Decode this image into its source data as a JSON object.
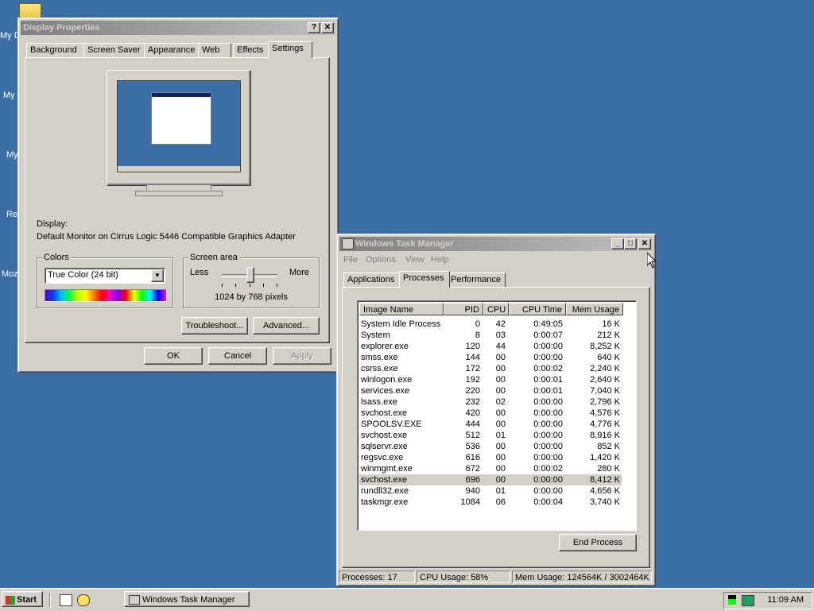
{
  "desktop": {
    "icons": [
      "My D",
      "My",
      "My",
      "Re",
      "Moz"
    ]
  },
  "display_properties": {
    "title": "Display Properties",
    "help_btn": "?",
    "close_btn": "✕",
    "tabs": [
      "Background",
      "Screen Saver",
      "Appearance",
      "Web",
      "Effects",
      "Settings"
    ],
    "active_tab": "Settings",
    "display_label": "Display:",
    "display_value": "Default Monitor on Cirrus Logic 5446 Compatible Graphics Adapter",
    "colors_label": "Colors",
    "colors_value": "True Color (24 bit)",
    "screen_area_label": "Screen area",
    "less": "Less",
    "more": "More",
    "resolution": "1024 by 768 pixels",
    "troubleshoot": "Troubleshoot...",
    "advanced": "Advanced...",
    "ok": "OK",
    "cancel": "Cancel",
    "apply": "Apply"
  },
  "task_manager": {
    "title": "Windows Task Manager",
    "menu": [
      "File",
      "Options",
      "View",
      "Help"
    ],
    "tabs": [
      "Applications",
      "Processes",
      "Performance"
    ],
    "active_tab": "Processes",
    "columns": [
      "Image Name",
      "PID",
      "CPU",
      "CPU Time",
      "Mem Usage"
    ],
    "processes": [
      {
        "name": "System Idle Process",
        "pid": "0",
        "cpu": "42",
        "time": "0:49:05",
        "mem": "16 K"
      },
      {
        "name": "System",
        "pid": "8",
        "cpu": "03",
        "time": "0:00:07",
        "mem": "212 K"
      },
      {
        "name": "explorer.exe",
        "pid": "120",
        "cpu": "44",
        "time": "0:00:00",
        "mem": "8,252 K"
      },
      {
        "name": "smss.exe",
        "pid": "144",
        "cpu": "00",
        "time": "0:00:00",
        "mem": "640 K"
      },
      {
        "name": "csrss.exe",
        "pid": "172",
        "cpu": "00",
        "time": "0:00:02",
        "mem": "2,240 K"
      },
      {
        "name": "winlogon.exe",
        "pid": "192",
        "cpu": "00",
        "time": "0:00:01",
        "mem": "2,640 K"
      },
      {
        "name": "services.exe",
        "pid": "220",
        "cpu": "00",
        "time": "0:00:01",
        "mem": "7,040 K"
      },
      {
        "name": "lsass.exe",
        "pid": "232",
        "cpu": "02",
        "time": "0:00:00",
        "mem": "2,796 K"
      },
      {
        "name": "svchost.exe",
        "pid": "420",
        "cpu": "00",
        "time": "0:00:00",
        "mem": "4,576 K"
      },
      {
        "name": "SPOOLSV.EXE",
        "pid": "444",
        "cpu": "00",
        "time": "0:00:00",
        "mem": "4,776 K"
      },
      {
        "name": "svchost.exe",
        "pid": "512",
        "cpu": "01",
        "time": "0:00:00",
        "mem": "8,916 K"
      },
      {
        "name": "sqlservr.exe",
        "pid": "536",
        "cpu": "00",
        "time": "0:00:00",
        "mem": "852 K"
      },
      {
        "name": "regsvc.exe",
        "pid": "616",
        "cpu": "00",
        "time": "0:00:00",
        "mem": "1,420 K"
      },
      {
        "name": "winmgmt.exe",
        "pid": "672",
        "cpu": "00",
        "time": "0:00:02",
        "mem": "280 K"
      },
      {
        "name": "svchost.exe",
        "pid": "696",
        "cpu": "00",
        "time": "0:00:00",
        "mem": "8,412 K"
      },
      {
        "name": "rundll32.exe",
        "pid": "940",
        "cpu": "01",
        "time": "0:00:00",
        "mem": "4,656 K"
      },
      {
        "name": "taskmgr.exe",
        "pid": "1084",
        "cpu": "06",
        "time": "0:00:04",
        "mem": "3,740 K"
      }
    ],
    "selected_index": 14,
    "end_process": "End Process",
    "status": {
      "processes": "Processes: 17",
      "cpu": "CPU Usage: 58%",
      "mem": "Mem Usage: 124564K / 3002464K"
    }
  },
  "taskbar": {
    "start": "Start",
    "task": "Windows Task Manager",
    "clock": "11:09 AM"
  }
}
